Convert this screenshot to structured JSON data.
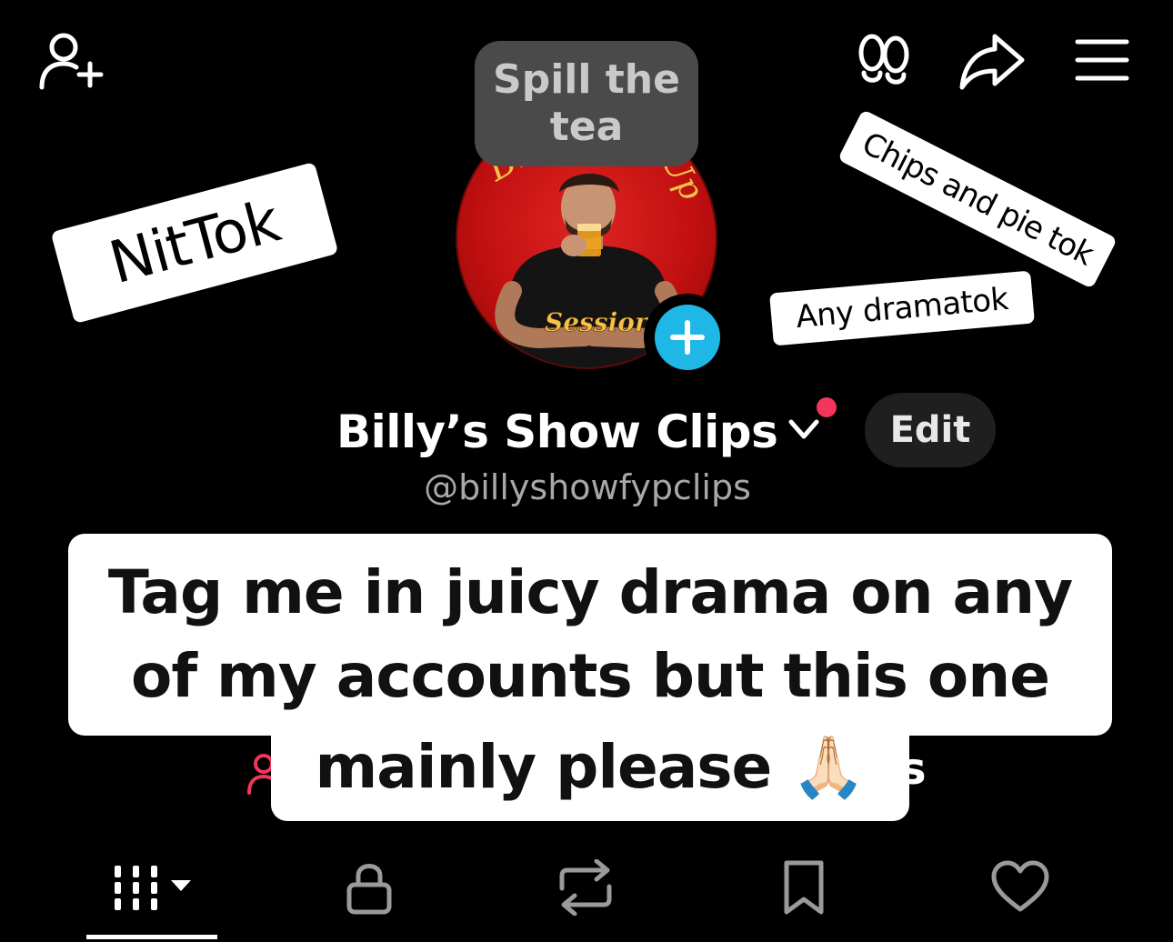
{
  "header": {
    "tea_bubble": "Spill the tea"
  },
  "stickers": {
    "nittok": "NitTok",
    "chips": "Chips and pie tok",
    "drama": "Any dramatok"
  },
  "avatar": {
    "top_text": "Billy",
    "top_text_right": "Up",
    "bottom_text": "Sessions"
  },
  "profile": {
    "display_name": "Billy’s Show Clips",
    "handle": "@billyshowfypclips",
    "edit_label": "Edit"
  },
  "bio": {
    "line1": "Tag me in juicy drama on any",
    "line2": "of my accounts but this one",
    "line3": "mainly please 🙏🏻"
  },
  "hidden_behind": {
    "trailing_s": "s"
  },
  "colors": {
    "accent_red": "#f2365a",
    "add_blue": "#1fb8e6",
    "bubble_gray": "#4a4a4a"
  },
  "tabs": [
    {
      "icon": "grid-icon",
      "active": true
    },
    {
      "icon": "lock-icon",
      "active": false
    },
    {
      "icon": "repost-icon",
      "active": false
    },
    {
      "icon": "bookmark-icon",
      "active": false
    },
    {
      "icon": "heart-icon",
      "active": false
    }
  ]
}
